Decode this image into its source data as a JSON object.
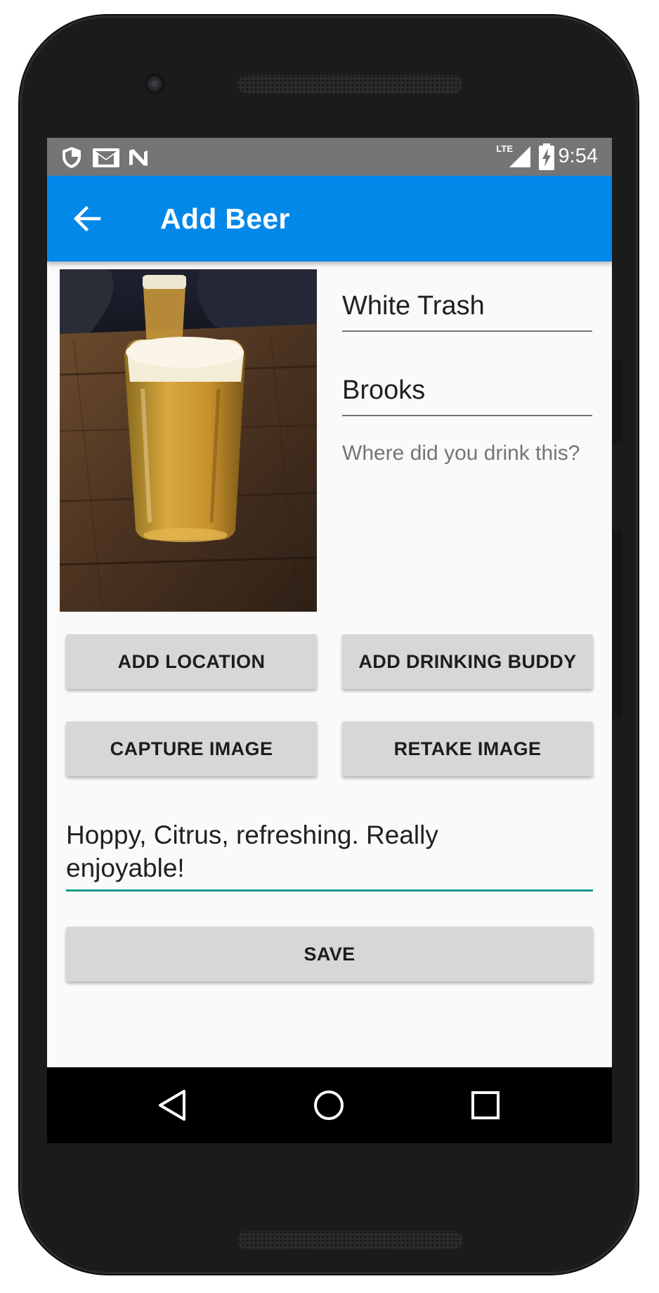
{
  "status_bar": {
    "time": "9:54",
    "network_label": "LTE",
    "icons": [
      "shield-icon",
      "gmail-icon",
      "n-icon",
      "signal-icon",
      "battery-charging-icon"
    ]
  },
  "app_bar": {
    "title": "Add Beer",
    "back_icon": "arrow-back-icon",
    "color": "#0288e8"
  },
  "form": {
    "beer_name": "White Trash",
    "brewery": "Brooks",
    "location_placeholder": "Where did you drink this?",
    "notes": "Hoppy, Citrus, refreshing. Really enjoyable!",
    "notes_accent": "#139b8b"
  },
  "buttons": {
    "add_location": "ADD LOCATION",
    "add_drinking_buddy": "ADD DRINKING BUDDY",
    "capture_image": "CAPTURE IMAGE",
    "retake_image": "RETAKE IMAGE",
    "save": "SAVE"
  },
  "nav_bar": {
    "icons": [
      "nav-back-icon",
      "nav-home-icon",
      "nav-recents-icon"
    ]
  }
}
